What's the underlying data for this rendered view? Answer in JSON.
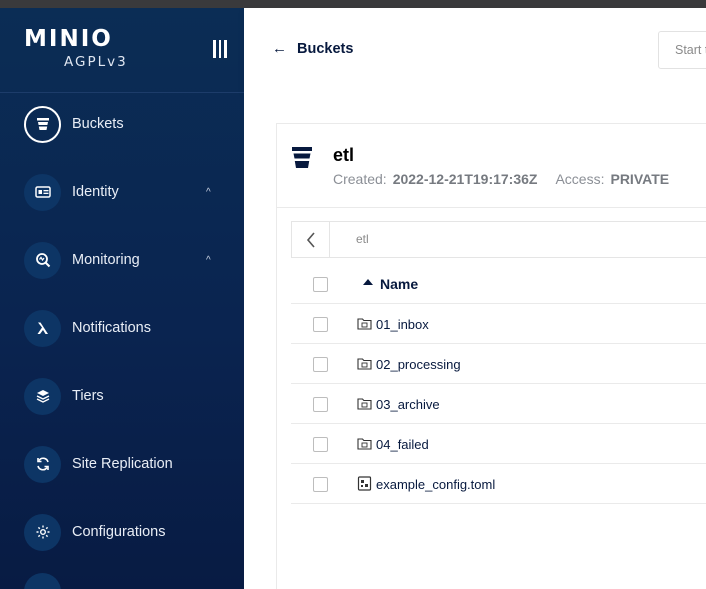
{
  "sidebar": {
    "logo": "MINIO",
    "license": "AGPLv3",
    "items": [
      {
        "label": "Buckets",
        "icon": "bucket-icon",
        "active": true
      },
      {
        "label": "Identity",
        "icon": "id-card-icon",
        "chevron": "^"
      },
      {
        "label": "Monitoring",
        "icon": "monitoring-icon",
        "chevron": "^"
      },
      {
        "label": "Notifications",
        "icon": "lambda-icon"
      },
      {
        "label": "Tiers",
        "icon": "layers-icon"
      },
      {
        "label": "Site Replication",
        "icon": "sync-icon"
      },
      {
        "label": "Configurations",
        "icon": "gear-icon"
      }
    ]
  },
  "header": {
    "back_label": "Buckets",
    "search_placeholder": "Start typing to filter objects in the bucket"
  },
  "bucket": {
    "name": "etl",
    "created_label": "Created:",
    "created_value": "2022-12-21T19:17:36Z",
    "access_label": "Access:",
    "access_value": "PRIVATE",
    "path": "etl"
  },
  "table": {
    "column_name": "Name",
    "rows": [
      {
        "name": "01_inbox",
        "type": "folder"
      },
      {
        "name": "02_processing",
        "type": "folder"
      },
      {
        "name": "03_archive",
        "type": "folder"
      },
      {
        "name": "04_failed",
        "type": "folder"
      },
      {
        "name": "example_config.toml",
        "type": "file"
      }
    ]
  },
  "colors": {
    "sidebar_bg": "#0a2450",
    "text_primary": "#07193e",
    "text_muted": "#8b8f96"
  }
}
